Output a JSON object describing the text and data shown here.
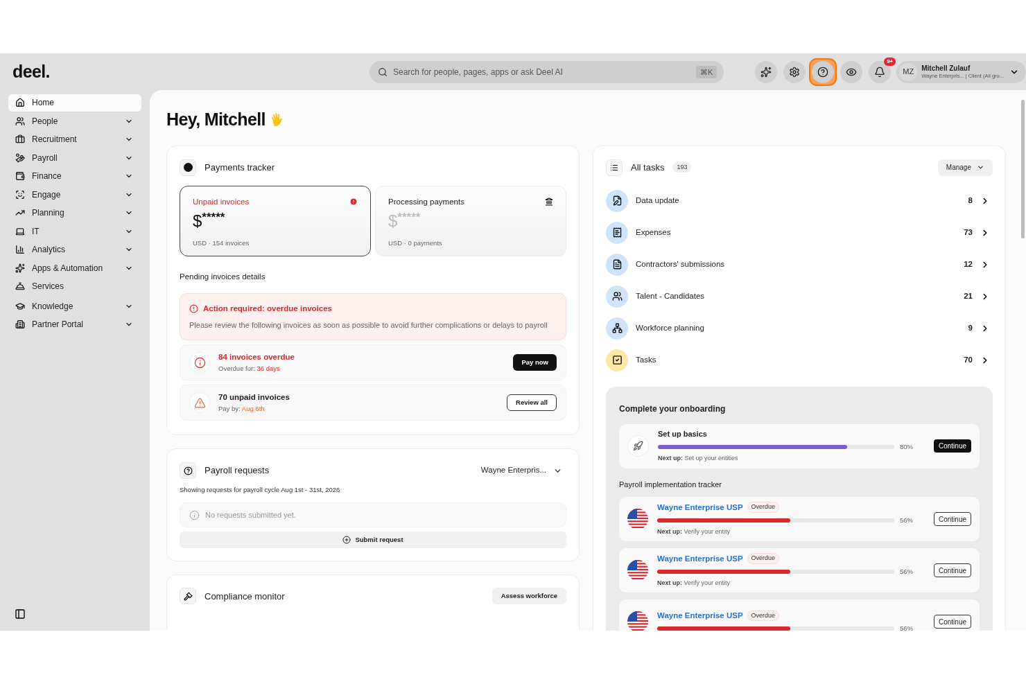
{
  "sidebar": {
    "logo": "deel.",
    "items": [
      {
        "label": "Home",
        "selected": true,
        "expandable": false
      },
      {
        "label": "People",
        "selected": false,
        "expandable": true
      },
      {
        "label": "Recruitment",
        "selected": false,
        "expandable": true
      },
      {
        "label": "Payroll",
        "selected": false,
        "expandable": true
      },
      {
        "label": "Finance",
        "selected": false,
        "expandable": true
      },
      {
        "label": "Engage",
        "selected": false,
        "expandable": true
      },
      {
        "label": "Planning",
        "selected": false,
        "expandable": true
      },
      {
        "label": "IT",
        "selected": false,
        "expandable": true
      },
      {
        "label": "Analytics",
        "selected": false,
        "expandable": true
      },
      {
        "label": "Apps & Automation",
        "selected": false,
        "expandable": true
      },
      {
        "label": "Services",
        "selected": false,
        "expandable": false
      },
      {
        "label": "Knowledge",
        "selected": false,
        "expandable": true
      },
      {
        "label": "Partner Portal",
        "selected": false,
        "expandable": true
      }
    ]
  },
  "header": {
    "search": {
      "placeholder": "Search for people, pages, apps or ask Deel AI",
      "shortcut": "⌘K"
    },
    "toolbar": [
      {
        "selected": false
      },
      {
        "selected": false
      },
      {
        "selected": true
      },
      {
        "selected": false
      },
      {
        "selected": false,
        "badge": "9+"
      }
    ],
    "user": {
      "initials": "MZ",
      "name": "Mitchell Zulauf",
      "subtitle": "Wayne Enterpris... | Client (All gro..."
    }
  },
  "greeting": "Hey, Mitchell",
  "payments_tracker": {
    "title": "Payments tracker",
    "cards": [
      {
        "kind": "unpaid",
        "selected": true,
        "label": "Unpaid invoices",
        "currency": "$",
        "amount": "*****",
        "meta": "USD · 154 invoices"
      },
      {
        "kind": "processing",
        "selected": false,
        "label": "Processing payments",
        "currency": "$",
        "amount": "*****",
        "meta": "USD · 0 payments"
      }
    ],
    "pending_title": "Pending invoices details",
    "alert": {
      "title": "Action required: overdue invoices",
      "message": "Please review the following invoices as soon as possible to avoid further complications or delays to payroll"
    },
    "rows": [
      {
        "kind": "overdue",
        "title": "84 invoices overdue",
        "detail_label": "Overdue for:",
        "detail_value": "36 days",
        "button": "Pay now"
      },
      {
        "kind": "unpaid",
        "title": "70 unpaid invoices",
        "detail_label": "Pay by:",
        "detail_value": "Aug 6th",
        "button": "Review all"
      }
    ]
  },
  "payroll_requests": {
    "title": "Payroll requests",
    "entity": "Wayne Enterpris...",
    "subtitle": "Showing requests for payroll cycle Aug 1st - 31st, 2026",
    "empty": "No requests submitted yet.",
    "button": "Submit request"
  },
  "compliance": {
    "title": "Compliance monitor",
    "button": "Assess workforce"
  },
  "tasks": {
    "title": "All tasks",
    "count": "193",
    "manage": "Manage",
    "items": [
      {
        "kind": "data",
        "label": "Data update",
        "count": "8",
        "color": "#cfe3fb"
      },
      {
        "kind": "expenses",
        "label": "Expenses",
        "count": "73",
        "color": "#cfe3fb"
      },
      {
        "kind": "submissions",
        "label": "Contractors' submissions",
        "count": "12",
        "color": "#cfe3fb"
      },
      {
        "kind": "talent",
        "label": "Talent - Candidates",
        "count": "21",
        "color": "#cfe3fb"
      },
      {
        "kind": "workforce",
        "label": "Workforce planning",
        "count": "9",
        "color": "#cfe3fb"
      },
      {
        "kind": "tasks",
        "label": "Tasks",
        "count": "70",
        "color": "#fde7a6"
      }
    ]
  },
  "onboarding": {
    "title": "Complete your onboarding",
    "step": {
      "title": "Set up basics",
      "level": 0.8,
      "percent": "80%",
      "next_label": "Next up:",
      "next_value": "Set up your entities",
      "button": "Continue"
    },
    "tracker_title": "Payroll implementation tracker",
    "entities": [
      {
        "name": "Wayne Enterprise USP",
        "status": "Overdue",
        "level": 0.56,
        "percent": "56%",
        "next_label": "Next up:",
        "next_value": "Verify your entity",
        "button": "Continue"
      },
      {
        "name": "Wayne Enterprise USP",
        "status": "Overdue",
        "level": 0.56,
        "percent": "56%",
        "next_label": "Next up:",
        "next_value": "Verify your entity",
        "button": "Continue"
      },
      {
        "name": "Wayne Enterprise USP",
        "status": "Overdue",
        "level": 0.56,
        "percent": "56%",
        "button": "Continue"
      }
    ]
  }
}
